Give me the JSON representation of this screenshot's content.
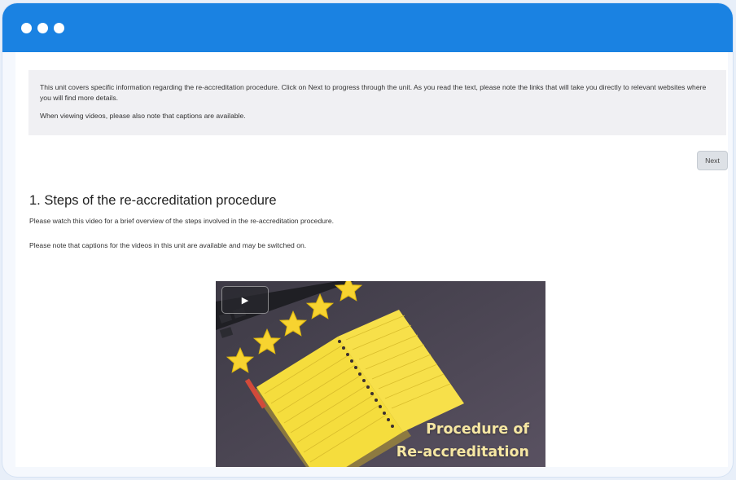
{
  "info_box": {
    "paragraph1": "This unit covers specific information regarding the re-accreditation procedure. Click on Next to progress through the unit. As you read the text, please note the links that will take you directly to relevant websites where you will find more details.",
    "paragraph2": "When viewing videos, please also note that captions are available."
  },
  "nav": {
    "next_label": "Next"
  },
  "section": {
    "heading": "1. Steps of the re-accreditation procedure",
    "intro": "Please watch this video for a brief overview of the steps involved in the re-accreditation procedure.",
    "captions_note": "Please note that captions for the videos in this unit are available and may be switched on."
  },
  "video": {
    "title_line1": "Procedure of",
    "title_line2": "Re-accreditation",
    "play_icon": "play-icon"
  },
  "colors": {
    "titlebar": "#1a82e2",
    "notebook": "#f5dd3d",
    "stars": "#f7d330",
    "video_bg": "#4a4456"
  }
}
